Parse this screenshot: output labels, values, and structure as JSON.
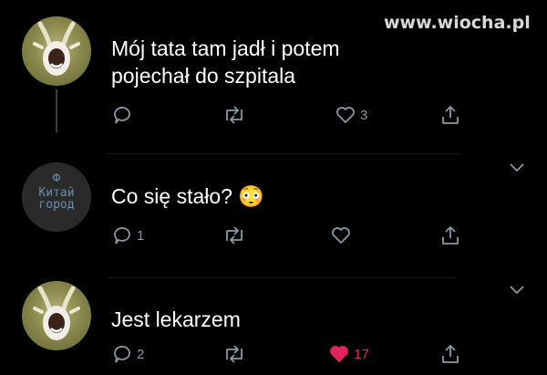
{
  "watermark": "www.wiocha.pl",
  "tweets": [
    {
      "text_lines": [
        "Mój tata tam jadł i potem",
        "pojechał do szpitala"
      ],
      "avatar": "goat-avatar",
      "actions": {
        "reply": "",
        "retweet": "",
        "like": "3",
        "liked": false
      }
    },
    {
      "avatar_text_top": "Китай",
      "avatar_text_bottom": "город",
      "text": "Co się stało? 😳",
      "actions": {
        "reply": "1",
        "retweet": "",
        "like": "",
        "liked": false
      }
    },
    {
      "text": "Jest lekarzem",
      "avatar": "goat-avatar",
      "actions": {
        "reply": "2",
        "retweet": "",
        "like": "17",
        "liked": true
      }
    }
  ],
  "colors": {
    "background": "#000000",
    "icon": "#8899a6",
    "like_active": "#e0245e",
    "text": "#ffffff"
  }
}
